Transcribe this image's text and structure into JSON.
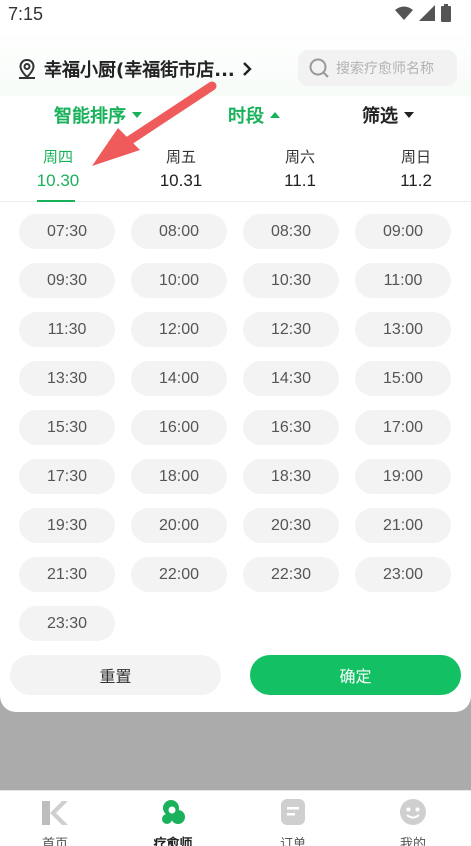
{
  "status_bar": {
    "time": "7:15"
  },
  "header": {
    "location": "幸福小厨(幸福街市店...",
    "search_placeholder": "搜索疗愈师名称"
  },
  "filters": {
    "items": [
      {
        "label": "智能排序",
        "state": "down"
      },
      {
        "label": "时段",
        "state": "up"
      },
      {
        "label": "筛选",
        "state": "down"
      }
    ]
  },
  "days": [
    {
      "week": "周四",
      "date": "10.30",
      "selected": true
    },
    {
      "week": "周五",
      "date": "10.31",
      "selected": false
    },
    {
      "week": "周六",
      "date": "11.1",
      "selected": false
    },
    {
      "week": "周日",
      "date": "11.2",
      "selected": false
    }
  ],
  "slots": [
    "07:30",
    "08:00",
    "08:30",
    "09:00",
    "09:30",
    "10:00",
    "10:30",
    "11:00",
    "11:30",
    "12:00",
    "12:30",
    "13:00",
    "13:30",
    "14:00",
    "14:30",
    "15:00",
    "15:30",
    "16:00",
    "16:30",
    "17:00",
    "17:30",
    "18:00",
    "18:30",
    "19:00",
    "19:30",
    "20:00",
    "20:30",
    "21:00",
    "21:30",
    "22:00",
    "22:30",
    "23:00",
    "23:30"
  ],
  "actions": {
    "reset": "重置",
    "confirm": "确定"
  },
  "tabbar": [
    {
      "label": "首页",
      "icon": "home-k-icon",
      "active": false
    },
    {
      "label": "疗愈师",
      "icon": "therapist-icon",
      "active": true
    },
    {
      "label": "订单",
      "icon": "order-icon",
      "active": false
    },
    {
      "label": "我的",
      "icon": "profile-icon",
      "active": false
    }
  ],
  "colors": {
    "accent": "#19b25b",
    "confirm": "#13c063",
    "annotation_arrow": "#ef5a5a"
  }
}
